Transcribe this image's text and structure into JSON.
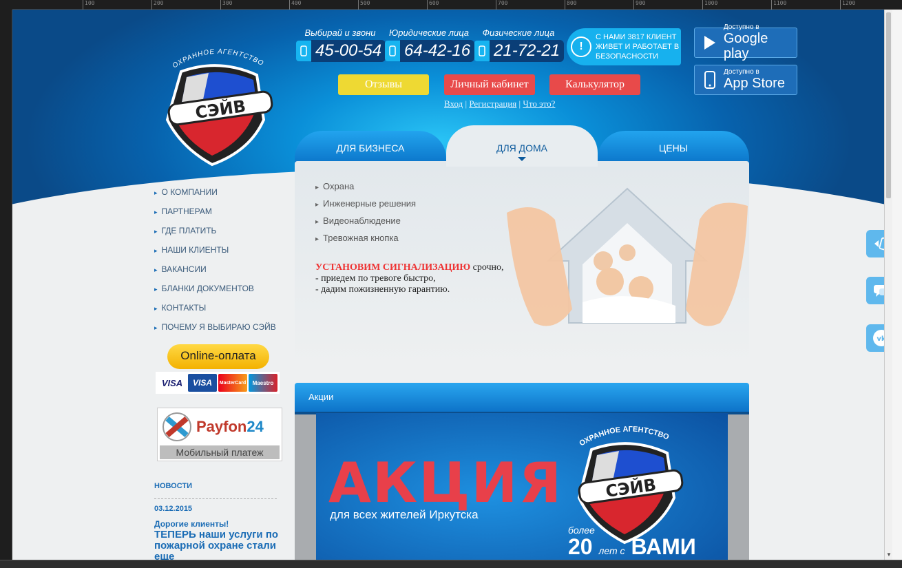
{
  "ruler": {
    "ticks": [
      "100",
      "200",
      "300",
      "400",
      "500",
      "600",
      "700",
      "800",
      "900",
      "1000",
      "1100",
      "1200"
    ]
  },
  "logo": {
    "agency": "ОХРАННОЕ АГЕНТСТВО",
    "name": "СЭЙВ"
  },
  "phones": [
    {
      "caption": "Выбирай и звони",
      "number": "45-00-54"
    },
    {
      "caption": "Юридические лица",
      "number": "64-42-16"
    },
    {
      "caption": "Физические лица",
      "number": "21-72-21"
    }
  ],
  "clients_badge": "С НАМИ 3817 КЛИЕНТ ЖИВЕТ И РАБОТАЕТ В БЕЗОПАСНОСТИ",
  "stores": [
    {
      "small": "Доступно в",
      "big": "Google play",
      "icon": "google-play-icon"
    },
    {
      "small": "Доступно в",
      "big": "App Store",
      "icon": "apple-icon"
    }
  ],
  "buttons": {
    "reviews": "Отзывы",
    "cabinet": "Личный кабинет",
    "calculator": "Калькулятор"
  },
  "auth": {
    "login": "Вход",
    "register": "Регистрация",
    "what": "Что это?",
    "sep": "|"
  },
  "tabs": [
    {
      "label": "ДЛЯ БИЗНЕСА",
      "active": false
    },
    {
      "label": "ДЛЯ ДОМА",
      "active": true
    },
    {
      "label": "ЦЕНЫ",
      "active": false
    }
  ],
  "submenu": [
    "Охрана",
    "Инженерные решения",
    "Видеонаблюдение",
    "Тревожная кнопка"
  ],
  "promo": {
    "headline": "УСТАНОВИМ СИГНАЛИЗАЦИЮ",
    "headline_tail": "срочно,",
    "line2": "- приедем по тревоге быстро,",
    "line3": "- дадим пожизненную гарантию."
  },
  "left_menu": [
    "О КОМПАНИИ",
    "ПАРТНЕРАМ",
    "ГДЕ ПЛАТИТЬ",
    "НАШИ КЛИЕНТЫ",
    "ВАКАНСИИ",
    "БЛАНКИ ДОКУМЕНТОВ",
    "КОНТАКТЫ",
    "ПОЧЕМУ Я ВЫБИРАЮ СЭЙВ"
  ],
  "online_payment": "Online-оплата",
  "cards": [
    "VISA",
    "VISA",
    "MasterCard",
    "Maestro"
  ],
  "payfon": {
    "name_a": "Payfon",
    "name_b": "24",
    "subtitle": "Мобильный платеж"
  },
  "news": {
    "heading": "НОВОСТИ",
    "date": "03.12.2015",
    "title": "Дорогие клиенты!",
    "text": "ТЕПЕРЬ наши услуги по пожарной охране стали еще"
  },
  "akcii": {
    "heading": "Акции",
    "banner_big": "АКЦИЯ",
    "banner_sub": "для всех жителей Иркутска",
    "banner_more": "более",
    "banner_num": "20",
    "banner_years": "лет с",
    "banner_you": "ВАМИ",
    "banner_agency": "ОХРАННОЕ АГЕНТСТВО",
    "banner_logo": "СЭЙВ"
  },
  "colors": {
    "brand_blue": "#0a73c8",
    "accent_red": "#e84a4a",
    "accent_yellow": "#eed933"
  }
}
